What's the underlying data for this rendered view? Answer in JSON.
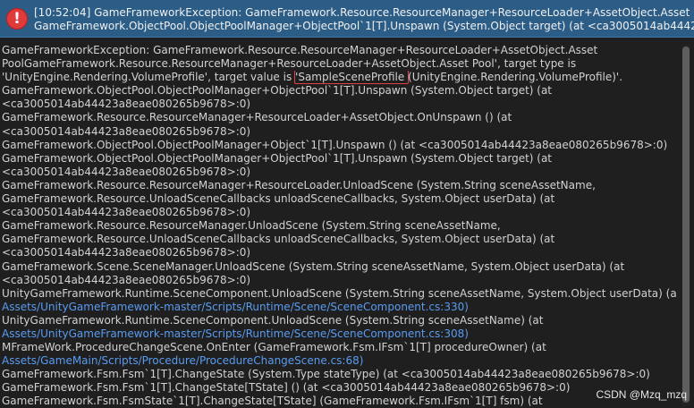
{
  "header": {
    "line1": "[10:52:04] GameFrameworkException: GameFramework.Resource.ResourceManager+ResourceLoader+AssetObject.Asset PoolGam",
    "line2": "GameFramework.ObjectPool.ObjectPoolManager+ObjectPool`1[T].Unspawn (System.Object target) (at <ca3005014ab44423a8eae",
    "icon": "error-icon"
  },
  "detail": {
    "lines": [
      {
        "text": "GameFrameworkException: GameFramework.Resource.ResourceManager+ResourceLoader+AssetObject.Asset",
        "link": false
      },
      {
        "text": "PoolGameFramework.Resource.ResourceManager+ResourceLoader+AssetObject.Asset Pool', target type is",
        "link": false
      },
      {
        "pre": "'UnityEngine.Rendering.VolumeProfile', target value is ",
        "hl": "'SampleSceneProfile ",
        "post": "(UnityEngine.Rendering.VolumeProfile)'.",
        "link": false
      },
      {
        "text": "GameFramework.ObjectPool.ObjectPoolManager+ObjectPool`1[T].Unspawn (System.Object target) (at",
        "link": false
      },
      {
        "text": "<ca3005014ab44423a8eae080265b9678>:0)",
        "link": false
      },
      {
        "text": "GameFramework.Resource.ResourceManager+ResourceLoader+AssetObject.OnUnspawn () (at",
        "link": false
      },
      {
        "text": "<ca3005014ab44423a8eae080265b9678>:0)",
        "link": false
      },
      {
        "text": "GameFramework.ObjectPool.ObjectPoolManager+Object`1[T].Unspawn () (at <ca3005014ab44423a8eae080265b9678>:0)",
        "link": false
      },
      {
        "text": "GameFramework.ObjectPool.ObjectPoolManager+ObjectPool`1[T].Unspawn (System.Object target) (at",
        "link": false
      },
      {
        "text": "<ca3005014ab44423a8eae080265b9678>:0)",
        "link": false
      },
      {
        "text": "GameFramework.Resource.ResourceManager+ResourceLoader.UnloadScene (System.String sceneAssetName,",
        "link": false
      },
      {
        "text": "GameFramework.Resource.UnloadSceneCallbacks unloadSceneCallbacks, System.Object userData) (at",
        "link": false
      },
      {
        "text": "<ca3005014ab44423a8eae080265b9678>:0)",
        "link": false
      },
      {
        "text": "GameFramework.Resource.ResourceManager.UnloadScene (System.String sceneAssetName,",
        "link": false
      },
      {
        "text": "GameFramework.Resource.UnloadSceneCallbacks unloadSceneCallbacks, System.Object userData) (at",
        "link": false
      },
      {
        "text": "<ca3005014ab44423a8eae080265b9678>:0)",
        "link": false
      },
      {
        "text": "GameFramework.Scene.SceneManager.UnloadScene (System.String sceneAssetName, System.Object userData) (at",
        "link": false
      },
      {
        "text": "<ca3005014ab44423a8eae080265b9678>:0)",
        "link": false
      },
      {
        "text": "UnityGameFramework.Runtime.SceneComponent.UnloadScene (System.String sceneAssetName, System.Object userData) (at",
        "link": false
      },
      {
        "text": "Assets/UnityGameFramework-master/Scripts/Runtime/Scene/SceneComponent.cs:330)",
        "link": true
      },
      {
        "text": "UnityGameFramework.Runtime.SceneComponent.UnloadScene (System.String sceneAssetName) (at",
        "link": false
      },
      {
        "text": "Assets/UnityGameFramework-master/Scripts/Runtime/Scene/SceneComponent.cs:308)",
        "link": true
      },
      {
        "text": "MFrameWork.ProcedureChangeScene.OnEnter (GameFramework.Fsm.IFsm`1[T] procedureOwner) (at",
        "link": false
      },
      {
        "text": "Assets/GameMain/Scripts/Procedure/ProcedureChangeScene.cs:68)",
        "link": true
      },
      {
        "text": "GameFramework.Fsm.Fsm`1[T].ChangeState (System.Type stateType) (at <ca3005014ab44423a8eae080265b9678>:0)",
        "link": false
      },
      {
        "text": "GameFramework.Fsm.Fsm`1[T].ChangeState[TState] () (at <ca3005014ab44423a8eae080265b9678>:0)",
        "link": false
      },
      {
        "text": "GameFramework.Fsm.FsmState`1[T].ChangeState[TState] (GameFramework.Fsm.IFsm`1[T] fsm) (at",
        "link": false
      }
    ]
  },
  "watermark": "CSDN @Mzq_mzq"
}
